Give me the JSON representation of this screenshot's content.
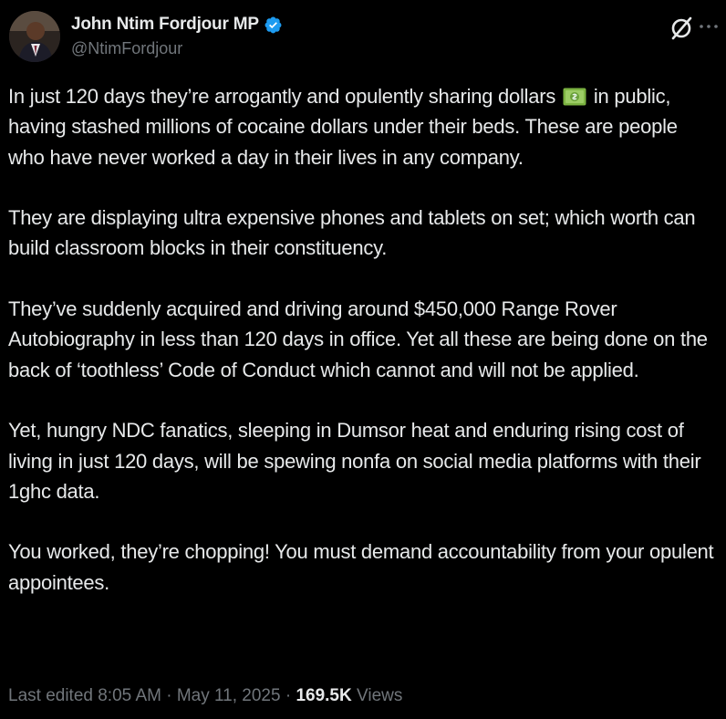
{
  "author": {
    "display_name": "John Ntim Fordjour MP",
    "handle": "@NtimFordjour",
    "verified": true
  },
  "icons": {
    "verified": "verified-badge-icon",
    "grok": "grok-slash-icon",
    "more": "more-options-icon",
    "emoji": "dollar-banknote-emoji"
  },
  "colors": {
    "background": "#000000",
    "text": "#e7e9ea",
    "secondary": "#71767b",
    "verified_blue": "#1d9bf0"
  },
  "tweet": {
    "p1_before_emoji": "In just 120 days they’re arrogantly and opulently sharing dollars",
    "p1_after_emoji": "in public, having stashed millions of cocaine dollars under their beds. These are people who have never worked a day in their lives in any company.",
    "p2": "They are displaying ultra expensive phones and tablets on set; which worth can build classroom blocks in their constituency.",
    "p3": "They’ve suddenly acquired and driving around $450,000 Range Rover Autobiography in less than 120 days in office. Yet all these are being done on the back of ‘toothless’ Code of Conduct which cannot and will not be applied.",
    "p4": "Yet, hungry NDC fanatics, sleeping in Dumsor heat and enduring rising cost of living in just 120 days, will be spewing nonfa on social media platforms with their 1ghc data.",
    "p5": "You worked, they’re chopping! You must demand accountability from your opulent appointees."
  },
  "meta": {
    "edited_label": "Last edited 8:05 AM · May 11, 2025 ·",
    "views_count": "169.5K",
    "views_label": "Views"
  }
}
